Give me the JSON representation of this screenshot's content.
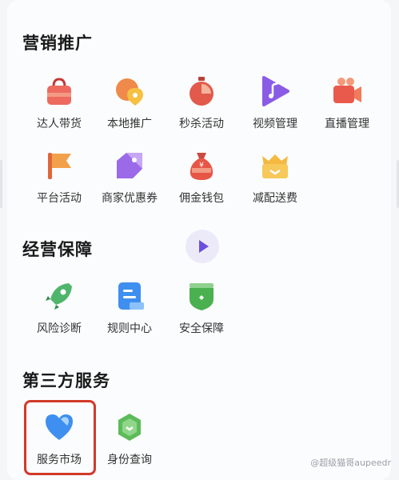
{
  "sections": {
    "marketing": {
      "title": "营销推广",
      "items": [
        {
          "label": "达人带货"
        },
        {
          "label": "本地推广"
        },
        {
          "label": "秒杀活动"
        },
        {
          "label": "视频管理"
        },
        {
          "label": "直播管理"
        },
        {
          "label": "平台活动"
        },
        {
          "label": "商家优惠券"
        },
        {
          "label": "佣金钱包"
        },
        {
          "label": "减配送费"
        }
      ]
    },
    "operation": {
      "title": "经营保障",
      "items": [
        {
          "label": "风险诊断"
        },
        {
          "label": "规则中心"
        },
        {
          "label": "安全保障"
        }
      ]
    },
    "thirdparty": {
      "title": "第三方服务",
      "items": [
        {
          "label": "服务市场"
        },
        {
          "label": "身份查询"
        }
      ]
    }
  },
  "wallet_icon_glyph": "¥",
  "watermark": "@超级猫哥aupeedr",
  "colors": {
    "accent_red": "#d23a2a",
    "play_purple": "#6b4ee0"
  }
}
